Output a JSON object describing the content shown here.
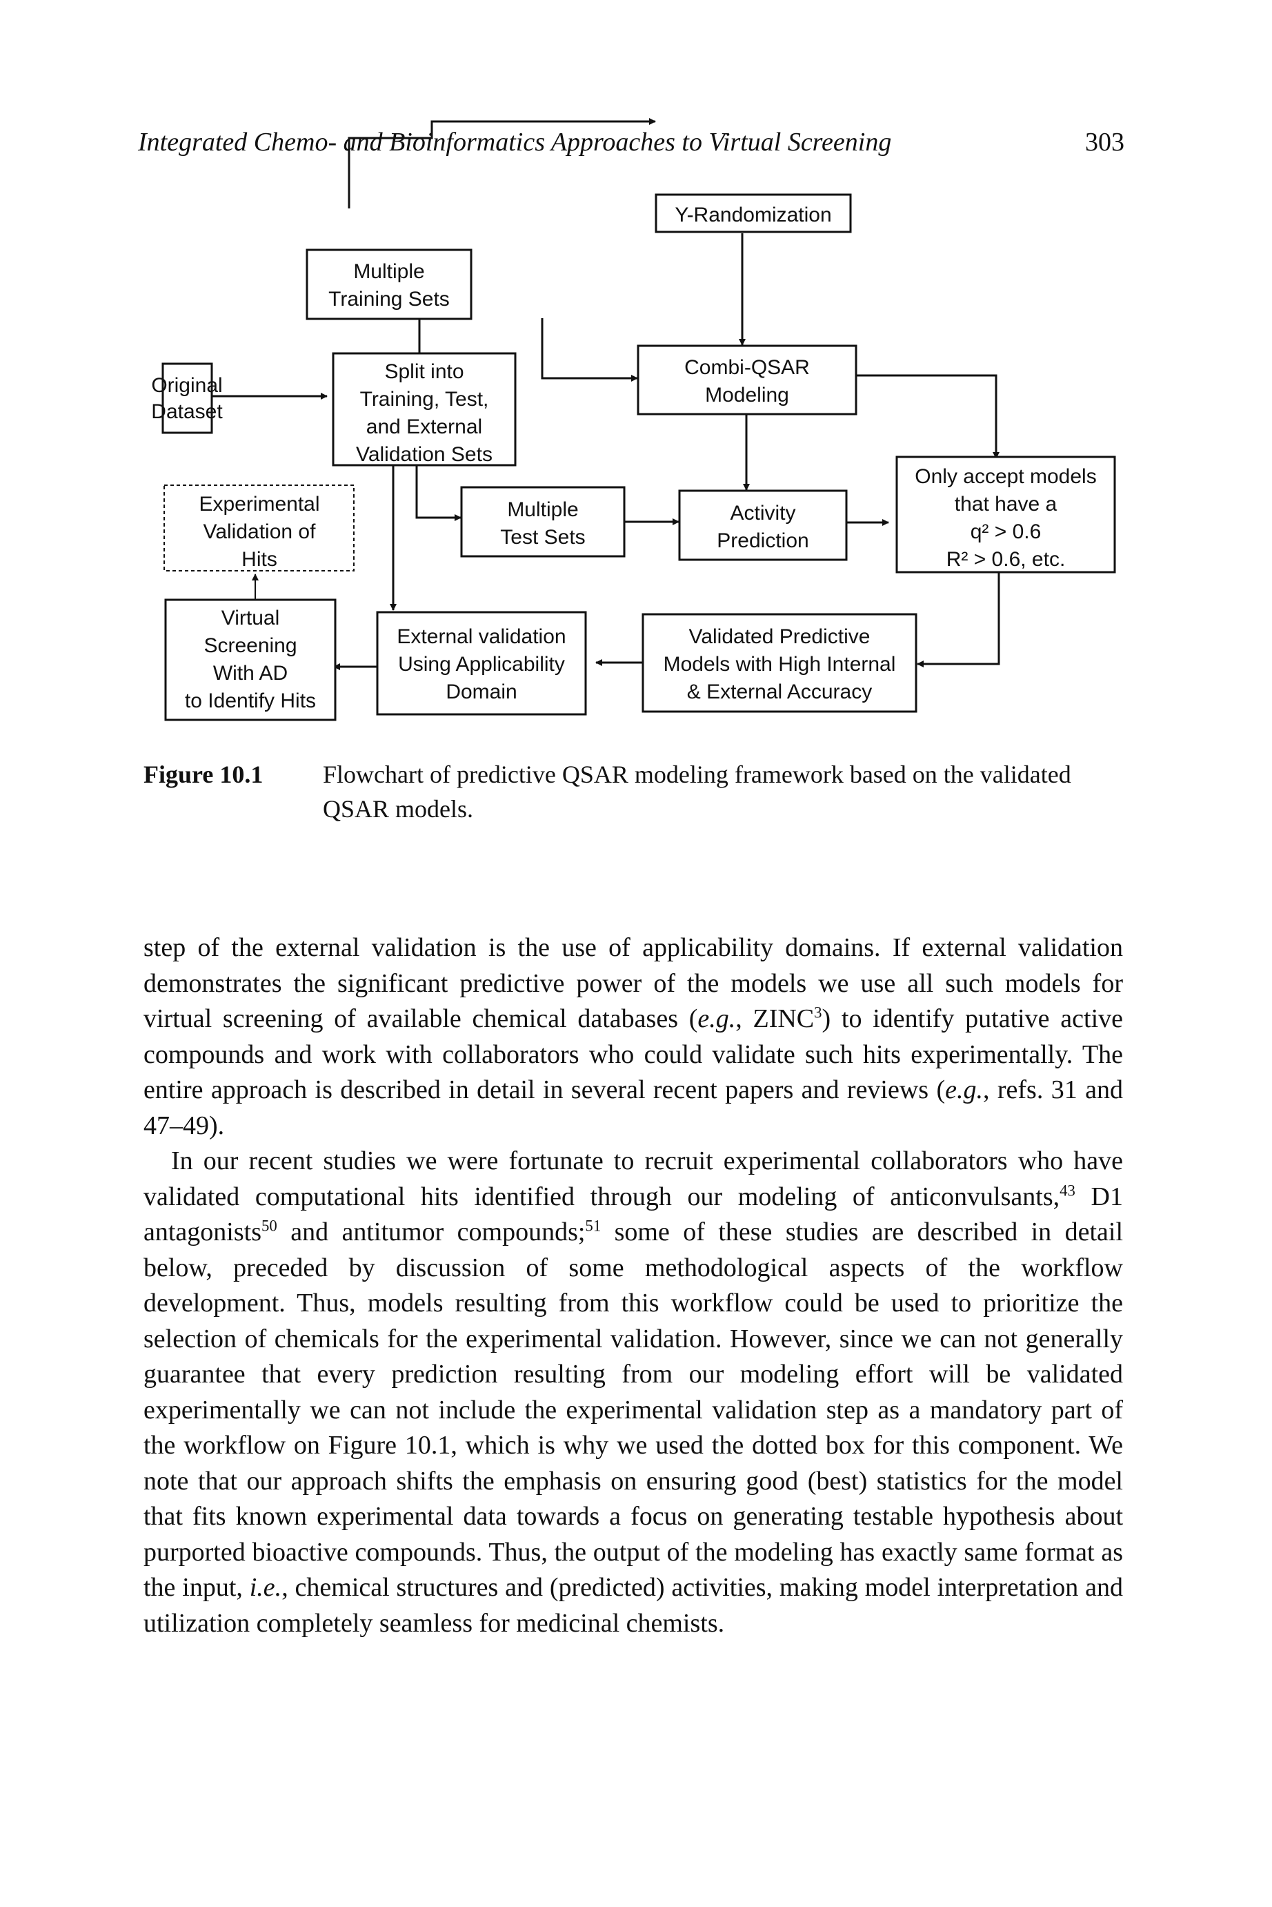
{
  "running_head": {
    "title": "Integrated Chemo- and Bioinformatics Approaches to Virtual Screening",
    "page_number": "303"
  },
  "figure": {
    "nodes": {
      "y_randomization": [
        "Y-Randomization"
      ],
      "multiple_training_sets": [
        "Multiple",
        "Training Sets"
      ],
      "original_dataset": [
        "Original",
        "Dataset"
      ],
      "split": [
        "Split into",
        "Training, Test,",
        "and External",
        "Validation Sets"
      ],
      "combi_qsar": [
        "Combi-QSAR",
        "Modeling"
      ],
      "experimental_validation": [
        "Experimental",
        "Validation of",
        "Hits"
      ],
      "multiple_test_sets": [
        "Multiple",
        "Test Sets"
      ],
      "activity_prediction": [
        "Activity",
        "Prediction"
      ],
      "accept_models": [
        "Only accept models",
        "that have a",
        "q² > 0.6",
        "R² > 0.6, etc."
      ],
      "virtual_screening": [
        "Virtual",
        "Screening",
        "With AD",
        "to Identify Hits"
      ],
      "external_validation": [
        "External validation",
        "Using Applicability",
        "Domain"
      ],
      "validated_models": [
        "Validated Predictive",
        "Models with High Internal",
        "& External Accuracy"
      ]
    },
    "caption_label": "Figure 10.1",
    "caption_text": "Flowchart of predictive QSAR modeling framework based on the validated QSAR models."
  },
  "body": {
    "p1_a": "step of the external validation is the use of applicability domains. If external validation demonstrates the significant predictive power of the models we use all such models for virtual screening of available chemical databases (",
    "p1_eg1": "e.g.",
    "p1_b": ", ZINC",
    "p1_sup1": "3",
    "p1_c": ") to identify putative active compounds and work with collaborators who could validate such hits experimentally. The entire approach is described in detail in several recent papers and reviews (",
    "p1_eg2": "e.g.",
    "p1_d": ", refs. 31 and 47–49).",
    "p2_a": "In our recent studies we were fortunate to recruit experimental collaborators who have validated computational hits identified through our modeling of anticonvulsants,",
    "p2_sup1": "43",
    "p2_b": " D1 antagonists",
    "p2_sup2": "50",
    "p2_c": " and antitumor compounds;",
    "p2_sup3": "51",
    "p2_d": " some of these studies are described in detail below, preceded by discussion of some methodological aspects of the workflow development. Thus, models resulting from this workflow could be used to prioritize the selection of chemicals for the experimental validation. However, since we can not generally guarantee that every prediction resulting from our modeling effort will be validated experimentally we can not include the experimental validation step as a mandatory part of the workflow on Figure 10.1, which is why we used the dotted box for this component. We note that our approach shifts the emphasis on ensuring good (best) statistics for the model that fits known experimental data towards a focus on generating testable hypothesis about purported bioactive compounds. Thus, the output of the modeling has exactly same format as the input, ",
    "p2_ie": "i.e.",
    "p2_e": ", chemical structures and (predicted) activities, making model interpretation and utilization completely seamless for medicinal chemists."
  }
}
